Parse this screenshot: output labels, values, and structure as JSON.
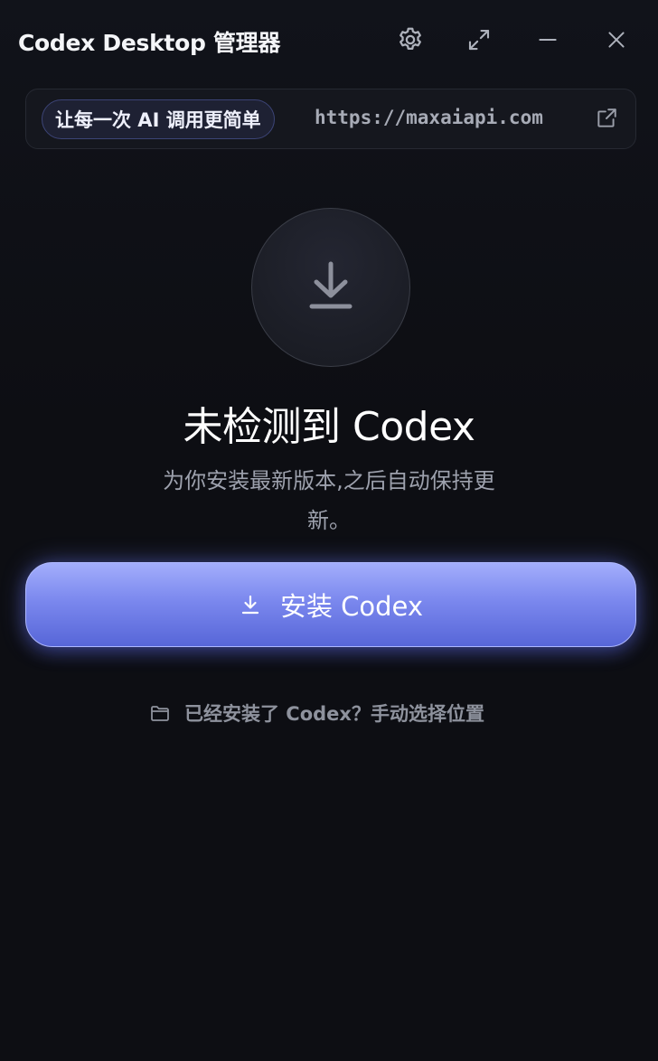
{
  "window": {
    "title": "Codex Desktop 管理器"
  },
  "titlebar_icons": {
    "settings": "gear-icon",
    "expand": "expand-icon",
    "minimize": "minimize-icon",
    "close": "close-icon"
  },
  "promo": {
    "badge": "让每一次 AI 调用更简单",
    "url": "https://maxaiapi.com",
    "link_icon": "external-link-icon"
  },
  "status": {
    "icon": "download-icon",
    "heading": "未检测到 Codex",
    "description": "为你安装最新版本,之后自动保持更新。"
  },
  "actions": {
    "install_label": "安装 Codex",
    "install_icon": "download-icon",
    "manual_label": "已经安装了 Codex？手动选择位置",
    "manual_icon": "folder-icon"
  },
  "colors": {
    "background": "#0d0e13",
    "accent_top": "#a3aefc",
    "accent_bottom": "#5766d8",
    "badge_border": "#3c4476",
    "muted_text": "#9da1ad"
  }
}
